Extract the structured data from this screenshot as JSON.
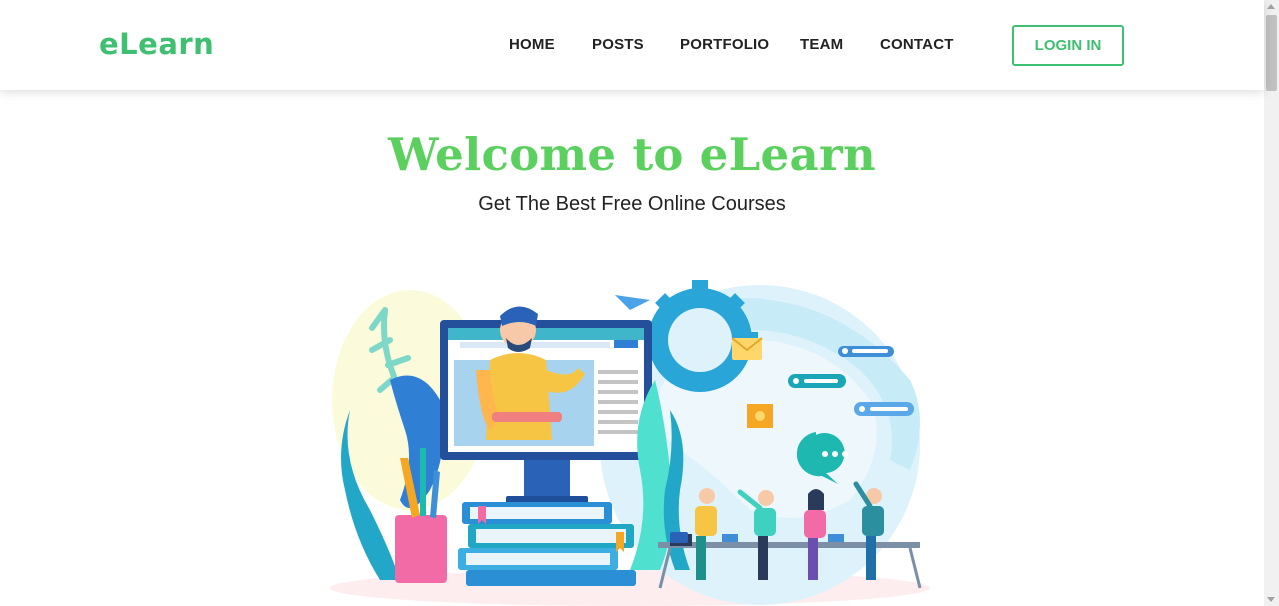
{
  "navbar": {
    "brand": "eLearn",
    "links": [
      {
        "label": "HOME"
      },
      {
        "label": "POSTS"
      },
      {
        "label": "PORTFOLIO"
      },
      {
        "label": "TEAM"
      },
      {
        "label": "CONTACT"
      }
    ],
    "login_label": "LOGIN IN"
  },
  "hero": {
    "title": "Welcome to eLearn",
    "subtitle": "Get The Best Free Online Courses"
  },
  "colors": {
    "brand_green": "#3fbf71",
    "title_green": "#5bd05f",
    "nav_text": "#222222"
  }
}
